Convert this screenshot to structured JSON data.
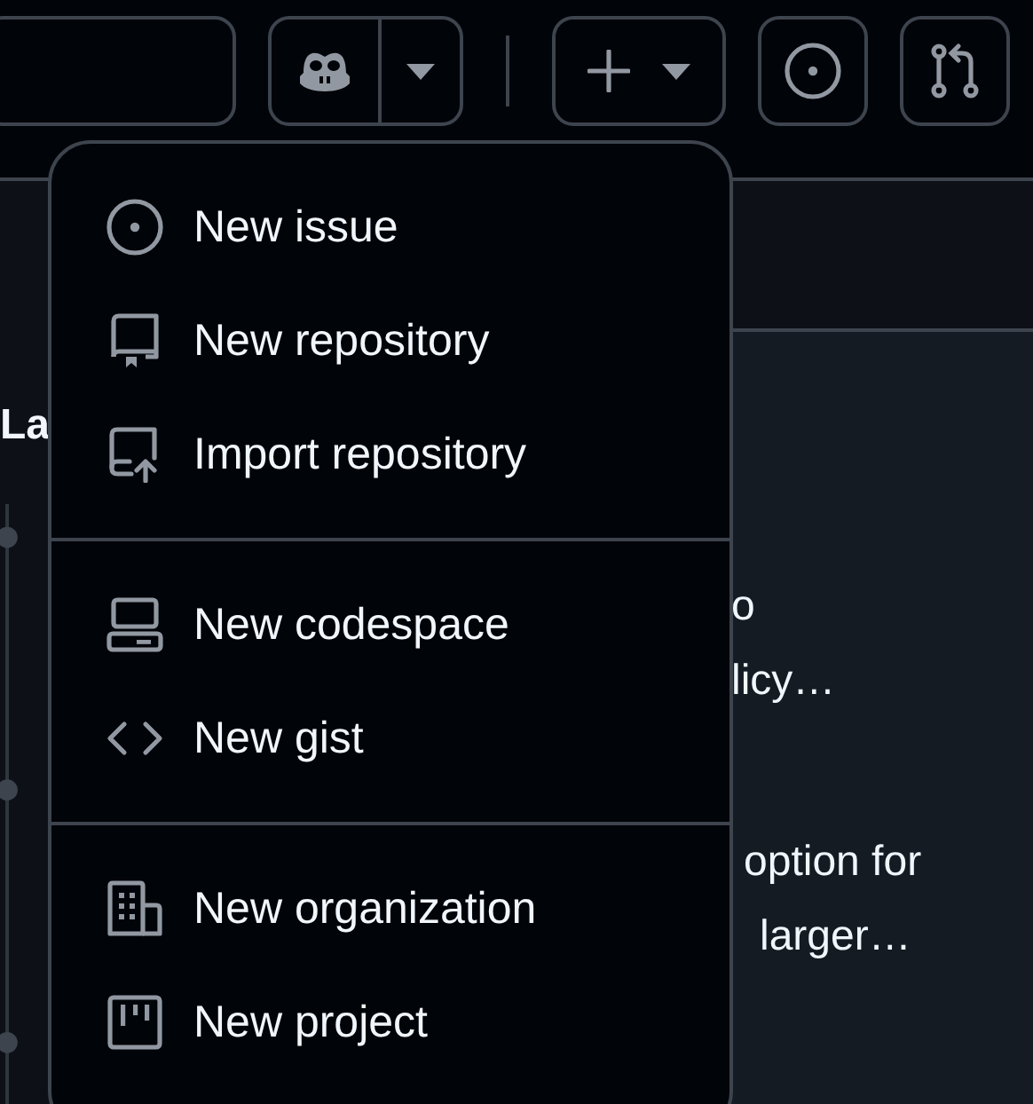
{
  "feed": {
    "heading": "La"
  },
  "card": {
    "groups": [
      [
        "o",
        "licy…"
      ],
      [
        "option for",
        "larger…"
      ]
    ]
  },
  "menu": {
    "groups": [
      {
        "items": [
          {
            "kind": "issue",
            "label": "New issue"
          },
          {
            "kind": "repo",
            "label": "New repository"
          },
          {
            "kind": "import",
            "label": "Import repository"
          }
        ]
      },
      {
        "items": [
          {
            "kind": "codespace",
            "label": "New codespace"
          },
          {
            "kind": "gist",
            "label": "New gist"
          }
        ]
      },
      {
        "items": [
          {
            "kind": "organization",
            "label": "New organization"
          },
          {
            "kind": "project",
            "label": "New project"
          }
        ]
      }
    ]
  }
}
